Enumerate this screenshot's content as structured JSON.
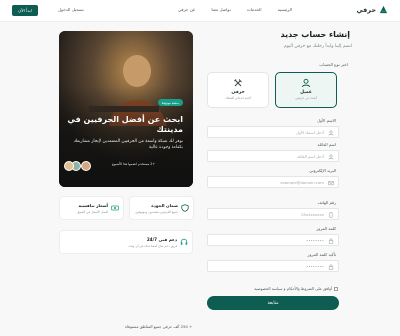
{
  "header": {
    "logo_text": "حرفي",
    "nav": [
      "الرئيسية",
      "الخدمات",
      "تواصل معنا",
      "عن حرفي"
    ],
    "login_label": "تسجيل الدخول",
    "start_label": "ابدأ الآن"
  },
  "form": {
    "title": "إنشاء حساب جديد",
    "subtitle": "انضم إلينا وابدأ رحلتك مع حرفي اليوم",
    "account_type_label": "اختر نوع الحساب",
    "account_types": [
      {
        "title": "عميل",
        "desc": "أبحث عن حرفيين",
        "icon": "user-icon",
        "selected": true
      },
      {
        "title": "حرفي",
        "desc": "أقدم خدماتي للعملاء",
        "icon": "tools-icon",
        "selected": false
      }
    ],
    "fields": [
      {
        "label": "الاسم الأول",
        "placeholder": "أدخل اسمك الأول",
        "icon": "user-icon"
      },
      {
        "label": "اسم العائلة",
        "placeholder": "أدخل اسم العائلة",
        "icon": "user-icon"
      },
      {
        "label": "البريد الإلكتروني",
        "placeholder": "example@domain.com",
        "icon": "mail-icon"
      },
      {
        "label": "رقم الهاتف",
        "placeholder": "05xxxxxxxx",
        "icon": "phone-icon"
      },
      {
        "label": "كلمة المرور",
        "placeholder": "••••••••",
        "icon": "lock-icon"
      },
      {
        "label": "تأكيد كلمة المرور",
        "placeholder": "••••••••",
        "icon": "lock-icon"
      }
    ],
    "terms": "أوافق على الشروط والأحكام و سياسة الخصوصية",
    "submit_label": "متابعة",
    "footnote": "+ 250 ألف حرفي جميع المناطق مستوفاة"
  },
  "hero": {
    "badge": "منصة موثوقة",
    "title": "ابحث عن أفضل الحرفيين في مدينتك",
    "description": "نوفر لك شبكة واسعة من الحرفيين المعتمدين لإنجاز مشاريعك بكفاءة وجودة عالية",
    "avatars_text": "+2 مستخدم انضموا هذا الأسبوع"
  },
  "features": [
    {
      "title": "ضمان الجودة",
      "desc": "جميع الحرفيين معتمدون وموثوقون",
      "icon": "shield-icon"
    },
    {
      "title": "أسعار تنافسية",
      "desc": "أفضل الأسعار في السوق",
      "icon": "money-icon"
    },
    {
      "title": "دعم فني 24/7",
      "desc": "فريق دعم متاح لمساعدتك في أي وقت",
      "icon": "headset-icon"
    }
  ],
  "colors": {
    "primary": "#0e5d52",
    "accent": "#1aa089"
  }
}
